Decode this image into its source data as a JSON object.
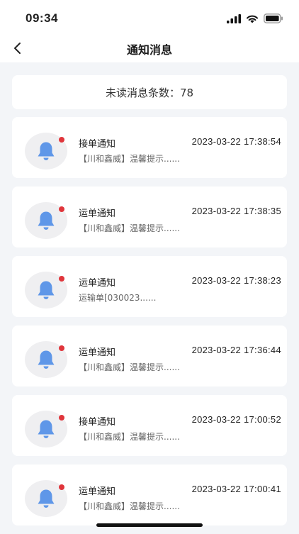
{
  "status_bar": {
    "time": "09:34"
  },
  "nav": {
    "title": "通知消息"
  },
  "summary": {
    "text": "未读消息条数：78"
  },
  "notifications": [
    {
      "title": "接单通知",
      "time": "2023-03-22 17:38:54",
      "preview": "【川和鑫威】温馨提示......"
    },
    {
      "title": "运单通知",
      "time": "2023-03-22 17:38:35",
      "preview": "【川和鑫威】温馨提示......"
    },
    {
      "title": "运单通知",
      "time": "2023-03-22 17:38:23",
      "preview": "运输单[030023......"
    },
    {
      "title": "运单通知",
      "time": "2023-03-22 17:36:44",
      "preview": "【川和鑫威】温馨提示......"
    },
    {
      "title": "接单通知",
      "time": "2023-03-22 17:00:52",
      "preview": "【川和鑫威】温馨提示......"
    },
    {
      "title": "运单通知",
      "time": "2023-03-22 17:00:41",
      "preview": "【川和鑫威】温馨提示......"
    }
  ],
  "colors": {
    "bell": "#5f97e8",
    "unread_dot": "#e0353b",
    "background": "#f3f5f8"
  }
}
